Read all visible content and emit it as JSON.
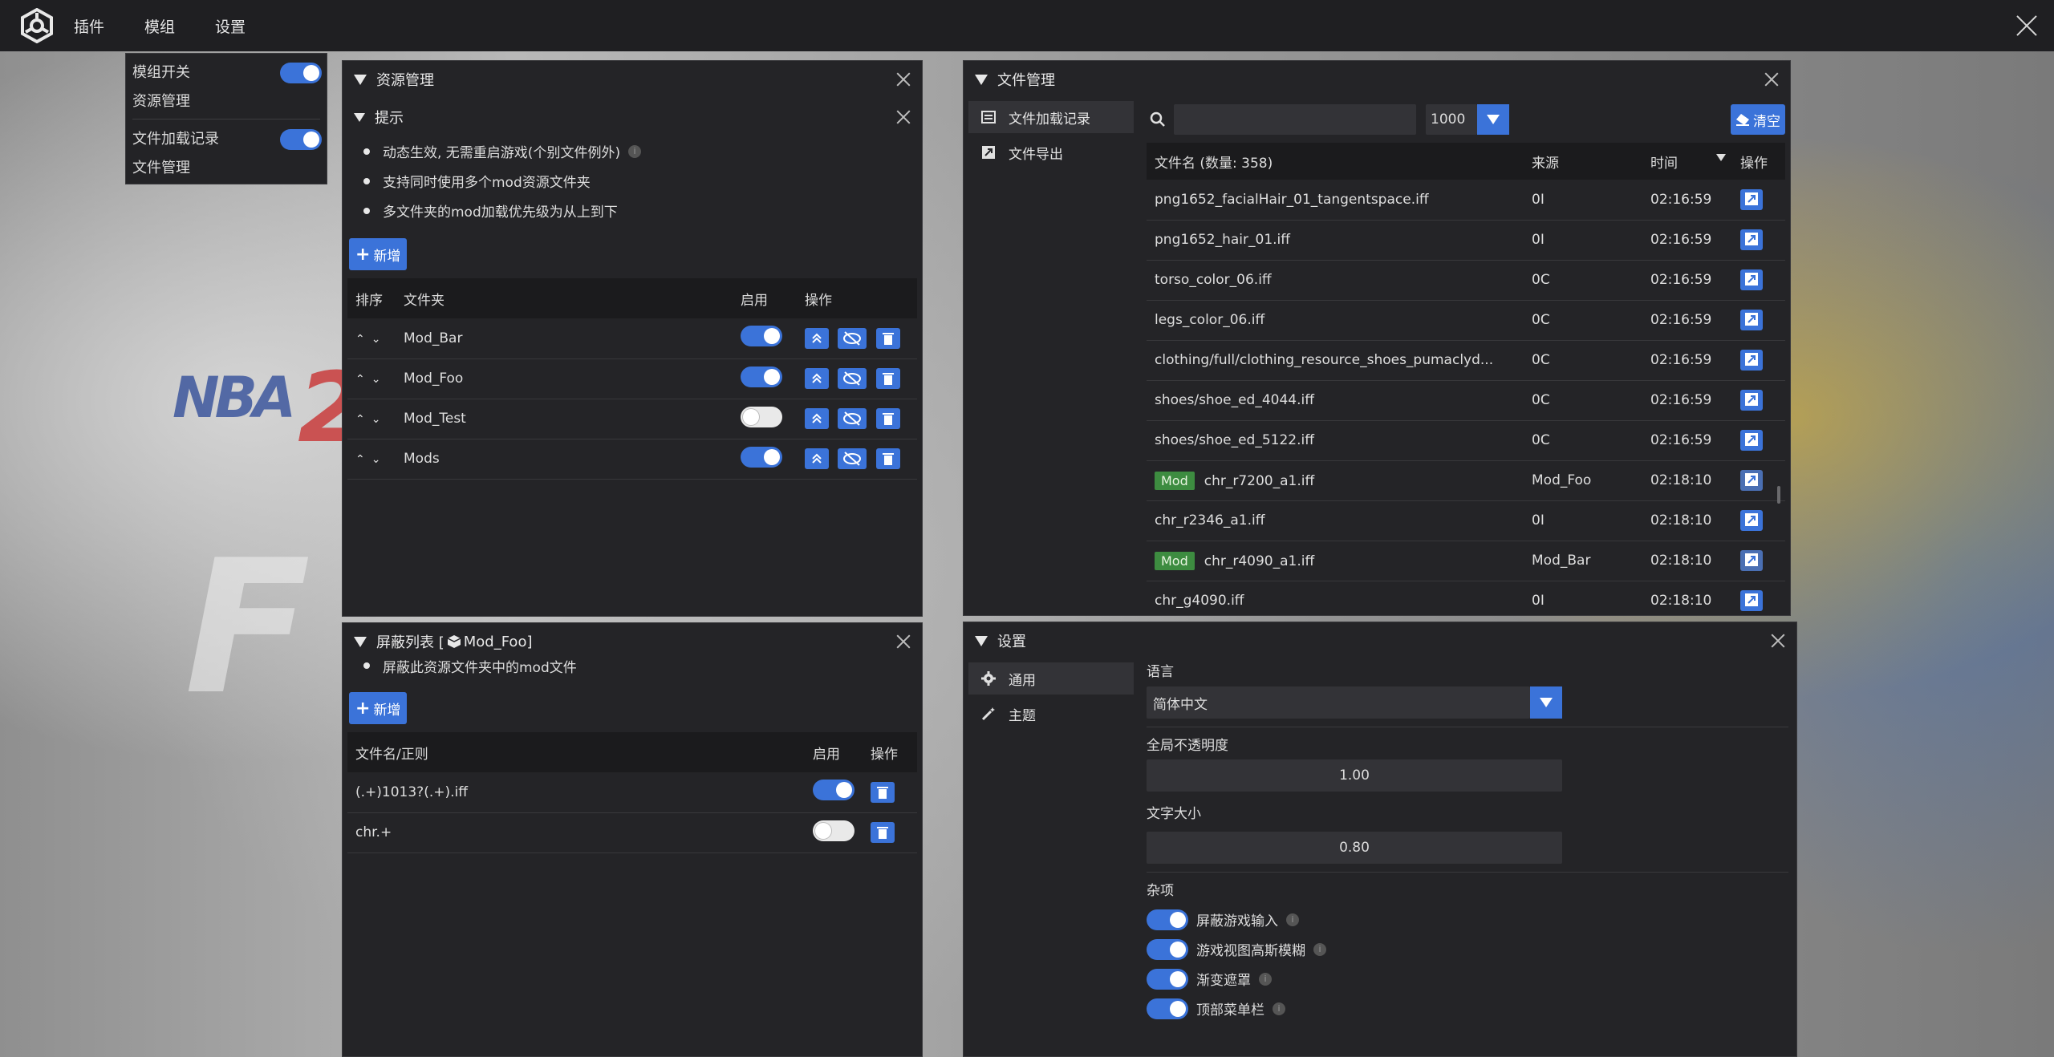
{
  "topbar": {
    "menus": [
      "插件",
      "模组",
      "设置"
    ]
  },
  "dropdown": {
    "item1": "模组开关",
    "item2": "资源管理",
    "item3": "文件加载记录",
    "item4": "文件管理"
  },
  "resource_panel": {
    "title": "资源管理",
    "tip_title": "提示",
    "tips": [
      "动态生效, 无需重启游戏(个别文件例外)",
      "支持同时使用多个mod资源文件夹",
      "多文件夹的mod加载优先级为从上到下"
    ],
    "add_label": "新增",
    "headers": [
      "排序",
      "文件夹",
      "启用",
      "操作"
    ],
    "rows": [
      {
        "name": "Mod_Bar",
        "enabled": true
      },
      {
        "name": "Mod_Foo",
        "enabled": true
      },
      {
        "name": "Mod_Test",
        "enabled": false
      },
      {
        "name": "Mods",
        "enabled": true
      }
    ]
  },
  "block_panel": {
    "title": "屏蔽列表 [",
    "title_folder": "Mod_Foo]",
    "tip": "屏蔽此资源文件夹中的mod文件",
    "add_label": "新增",
    "headers": [
      "文件名/正则",
      "启用",
      "操作"
    ],
    "rows": [
      {
        "pattern": "(.+)1013?(.+).iff",
        "enabled": true
      },
      {
        "pattern": "chr.+",
        "enabled": false
      }
    ]
  },
  "file_panel": {
    "title": "文件管理",
    "tabs": [
      "文件加载记录",
      "文件导出"
    ],
    "search_value": "",
    "limit_value": "1000",
    "clear_label": "清空",
    "headers": {
      "name": "文件名 (数量: 358)",
      "source": "来源",
      "time": "时间",
      "action": "操作"
    },
    "mod_tag": "Mod",
    "rows": [
      {
        "name": "png1652_facialHair_01_tangentspace.iff",
        "source": "0I",
        "time": "02:16:59",
        "mod": false
      },
      {
        "name": "png1652_hair_01.iff",
        "source": "0I",
        "time": "02:16:59",
        "mod": false
      },
      {
        "name": "torso_color_06.iff",
        "source": "0C",
        "time": "02:16:59",
        "mod": false
      },
      {
        "name": "legs_color_06.iff",
        "source": "0C",
        "time": "02:16:59",
        "mod": false
      },
      {
        "name": "clothing/full/clothing_resource_shoes_pumaclyd...",
        "source": "0C",
        "time": "02:16:59",
        "mod": false
      },
      {
        "name": "shoes/shoe_ed_4044.iff",
        "source": "0C",
        "time": "02:16:59",
        "mod": false
      },
      {
        "name": "shoes/shoe_ed_5122.iff",
        "source": "0C",
        "time": "02:16:59",
        "mod": false
      },
      {
        "name": "chr_r7200_a1.iff",
        "source": "Mod_Foo",
        "time": "02:18:10",
        "mod": true
      },
      {
        "name": "chr_r2346_a1.iff",
        "source": "0I",
        "time": "02:18:10",
        "mod": false
      },
      {
        "name": "chr_r4090_a1.iff",
        "source": "Mod_Bar",
        "time": "02:18:10",
        "mod": true
      },
      {
        "name": "chr_g4090.iff",
        "source": "0I",
        "time": "02:18:10",
        "mod": false
      }
    ]
  },
  "settings_panel": {
    "title": "设置",
    "tabs": [
      "通用",
      "主题"
    ],
    "language_label": "语言",
    "language_value": "简体中文",
    "opacity_label": "全局不透明度",
    "opacity_value": "1.00",
    "fontsize_label": "文字大小",
    "fontsize_value": "0.80",
    "misc_label": "杂项",
    "misc_items": [
      "屏蔽游戏输入",
      "游戏视图高斯模糊",
      "渐变遮罩",
      "顶部菜单栏"
    ]
  },
  "colors": {
    "accent": "#3b73d9",
    "panel": "#242427",
    "mod_tag": "#3d8c40"
  }
}
